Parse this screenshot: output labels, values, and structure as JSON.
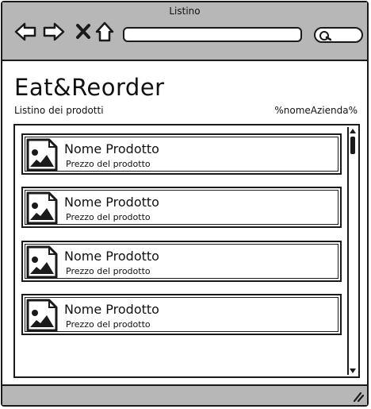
{
  "window": {
    "title": "Listino"
  },
  "browser": {
    "icons": [
      "back-arrow-icon",
      "forward-arrow-icon",
      "close-x-icon",
      "home-icon",
      "search-icon"
    ],
    "url_value": "",
    "search_value": ""
  },
  "app": {
    "title": "Eat&Reorder",
    "subtitle": "Listino dei prodotti",
    "company": "%nomeAzienda%"
  },
  "products": [
    {
      "name": "Nome Prodotto",
      "price": "Prezzo del prodotto",
      "icon": "image-placeholder-icon"
    },
    {
      "name": "Nome Prodotto",
      "price": "Prezzo del prodotto",
      "icon": "image-placeholder-icon"
    },
    {
      "name": "Nome Prodotto",
      "price": "Prezzo del prodotto",
      "icon": "image-placeholder-icon"
    },
    {
      "name": "Nome Prodotto",
      "price": "Prezzo del prodotto",
      "icon": "image-placeholder-icon"
    }
  ],
  "colors": {
    "chrome": "#b7b7b7",
    "stroke": "#1a1a1a",
    "background": "#ffffff"
  }
}
